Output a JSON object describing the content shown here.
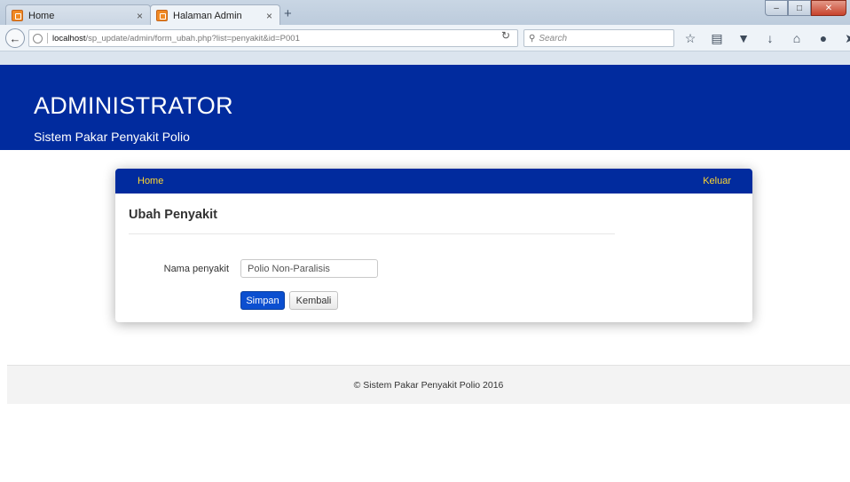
{
  "browser": {
    "tabs": [
      {
        "label": "Home",
        "close": "×"
      },
      {
        "label": "Halaman Admin",
        "close": "×"
      }
    ],
    "new_tab": "+",
    "window_controls": {
      "minimize": "–",
      "maximize": "□",
      "close": "✕"
    },
    "url_host": "localhost",
    "url_path": "/sp_update/admin/form_ubah.php?list=penyakit&id=P001",
    "search_placeholder": "Search",
    "icons": [
      "back-icon",
      "globe-icon",
      "reload-icon",
      "search-icon",
      "bookmark-star-icon",
      "reading-list-icon",
      "pocket-icon",
      "download-icon",
      "home-icon",
      "chat-icon",
      "send-icon",
      "menu-icon"
    ]
  },
  "header": {
    "title": "ADMINISTRATOR",
    "subtitle": "Sistem Pakar Penyakit Polio"
  },
  "panel": {
    "nav": {
      "home": "Home",
      "logout": "Keluar"
    },
    "title": "Ubah Penyakit",
    "form": {
      "label": "Nama penyakit",
      "value": "Polio Non-Paralisis"
    },
    "buttons": {
      "save": "Simpan",
      "back": "Kembali"
    }
  },
  "footer": {
    "text": "© Sistem Pakar Penyakit Polio 2016"
  },
  "colors": {
    "brand_blue": "#012b9e",
    "nav_link": "#ffd830",
    "primary_button": "#0b4fd0"
  }
}
